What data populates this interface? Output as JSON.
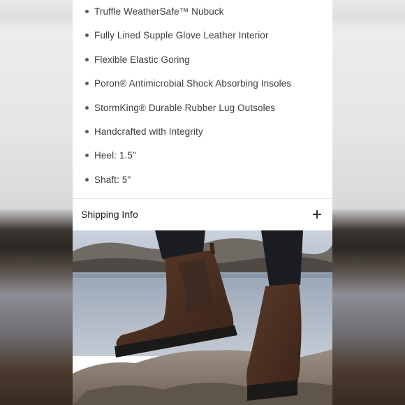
{
  "features": [
    "Truffle WeatherSafe™ Nubuck",
    "Fully Lined Supple Glove Leather Interior",
    "Flexible Elastic Goring",
    "Poron® Antimicrobial Shock Absorbing Insoles",
    "StormKing® Durable Rubber Lug Outsoles",
    "Handcrafted with Integrity",
    "Heel: 1.5\"",
    "Shaft: 5\""
  ],
  "shipping": {
    "label": "Shipping Info",
    "icon": "plus-icon"
  },
  "photo": {
    "subject": "brown chelsea boots on rock by a lake",
    "colors": {
      "boot": "#4a2f22",
      "sole": "#1c1a18",
      "jeans": "#1a1c22",
      "rock": "#8a7f73",
      "water": "#a9b4c3"
    }
  }
}
